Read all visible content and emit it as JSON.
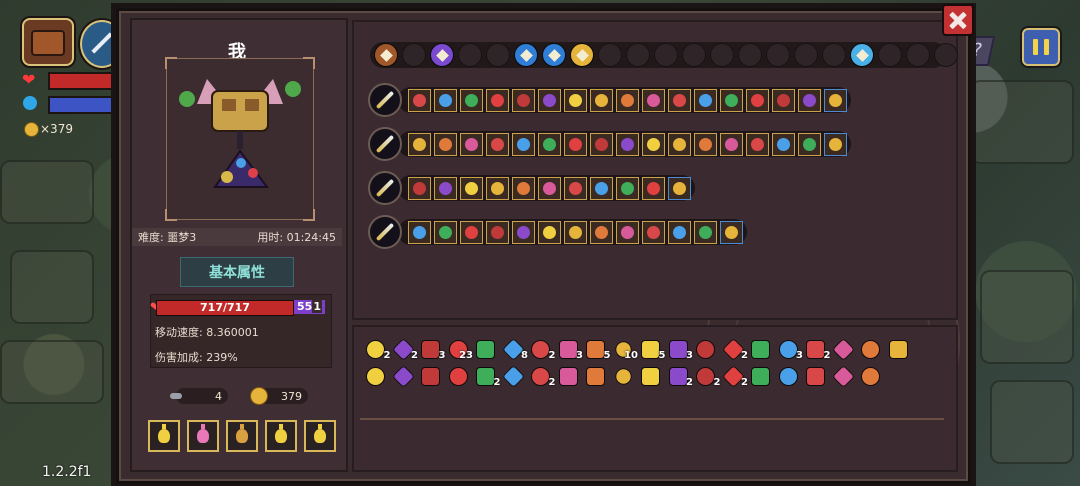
{
  "character": {
    "name": "我",
    "difficulty": "难度: 噩梦3",
    "time": "用时: 01:24:45",
    "tab_basic": "基本属性",
    "hp": "717/717",
    "shield": "55",
    "shield_suffix": "1",
    "move_speed": "移动速度: 8.360001",
    "damage_bonus": "伤害加成: 239%",
    "keys": "4",
    "gold": "379"
  },
  "hud": {
    "coins": "×379",
    "version": "1.2.2f1",
    "help_glyph": "?"
  },
  "colors": {
    "hp_red": "#c22a2a",
    "mana_blue": "#3d54c4",
    "shield_purple": "#7d3fc9",
    "gold": "#e6b43a"
  },
  "top_slots": {
    "total": 21,
    "filled": [
      {
        "index": 0,
        "icon": "chest-icon"
      },
      {
        "index": 2,
        "icon": "purple-crystal-icon"
      },
      {
        "index": 5,
        "icon": "blue-orb-icon"
      },
      {
        "index": 6,
        "icon": "blue-orb-icon"
      },
      {
        "index": 7,
        "icon": "gold-clover-icon"
      },
      {
        "index": 17,
        "icon": "blue-vial-icon"
      }
    ]
  },
  "weapons": [
    {
      "icon": "sword-icon",
      "mods": 17
    },
    {
      "icon": "staff-icon",
      "mods": 17
    },
    {
      "icon": "blue-sword-icon",
      "mods": 11
    },
    {
      "icon": "blue-blade-icon",
      "mods": 13
    }
  ],
  "inventory": {
    "row1": [
      {
        "icon": "hood-icon",
        "count": "2"
      },
      {
        "icon": "wand-icon",
        "count": "2"
      },
      {
        "icon": "spear-icon",
        "count": "3"
      },
      {
        "icon": "scroll-icon",
        "count": "23"
      },
      {
        "icon": "leaf-icon",
        "count": ""
      },
      {
        "icon": "net-icon",
        "count": "8"
      },
      {
        "icon": "arrow-icon",
        "count": "2"
      },
      {
        "icon": "crossbow-icon",
        "count": "3"
      },
      {
        "icon": "dragonfly-icon",
        "count": "5"
      },
      {
        "icon": "bolt-icon",
        "count": "10"
      },
      {
        "icon": "key-icon",
        "count": "5"
      },
      {
        "icon": "magnifier-icon",
        "count": "3"
      },
      {
        "icon": "bug-icon",
        "count": ""
      },
      {
        "icon": "brain-icon",
        "count": "2"
      },
      {
        "icon": "pill-icon",
        "count": ""
      },
      {
        "icon": "crown-icon",
        "count": "3"
      },
      {
        "icon": "book-icon",
        "count": "2"
      },
      {
        "icon": "horn-icon",
        "count": ""
      },
      {
        "icon": "feather-icon",
        "count": ""
      },
      {
        "icon": "clock-icon",
        "count": ""
      }
    ],
    "row2": [
      {
        "icon": "bird-icon",
        "count": ""
      },
      {
        "icon": "drop-icon",
        "count": ""
      },
      {
        "icon": "blade-icon",
        "count": ""
      },
      {
        "icon": "hook-icon",
        "count": ""
      },
      {
        "icon": "barrel-icon",
        "count": "2"
      },
      {
        "icon": "flame-icon",
        "count": ""
      },
      {
        "icon": "hammer-icon",
        "count": "2"
      },
      {
        "icon": "wing-icon",
        "count": ""
      },
      {
        "icon": "ticket-icon",
        "count": ""
      },
      {
        "icon": "map-icon",
        "count": ""
      },
      {
        "icon": "tube-icon",
        "count": ""
      },
      {
        "icon": "egg-icon",
        "count": "2"
      },
      {
        "icon": "swirl-icon",
        "count": "2"
      },
      {
        "icon": "clover-icon",
        "count": "2"
      },
      {
        "icon": "paper-icon",
        "count": ""
      },
      {
        "icon": "cone-icon",
        "count": ""
      },
      {
        "icon": "arrow-green-icon",
        "count": ""
      },
      {
        "icon": "sprout-icon",
        "count": ""
      },
      {
        "icon": "tooth-icon",
        "count": ""
      }
    ]
  }
}
